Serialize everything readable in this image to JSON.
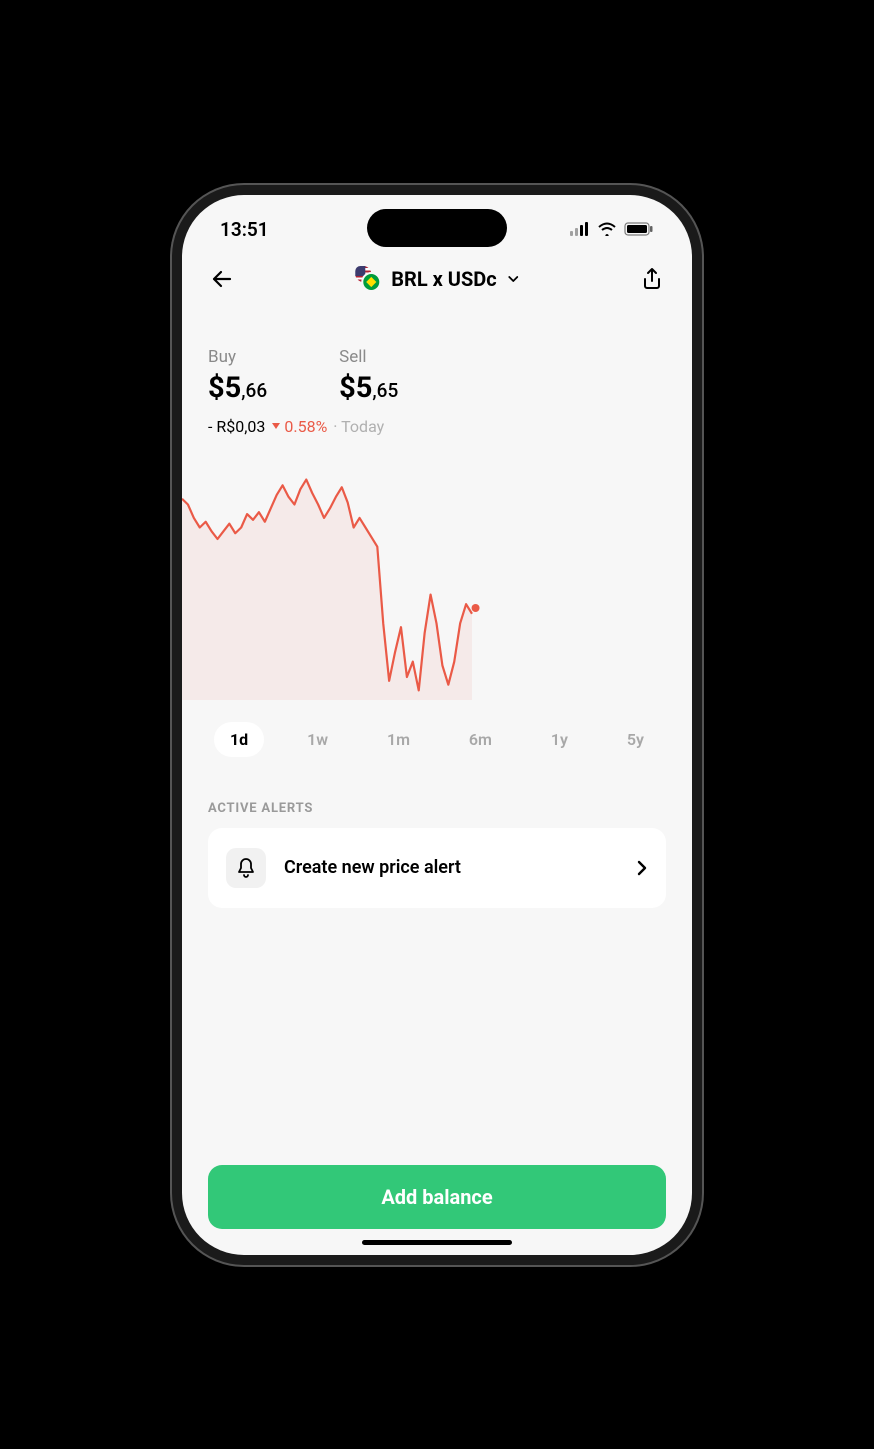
{
  "status_bar": {
    "time": "13:51"
  },
  "header": {
    "pair": "BRL x USDc"
  },
  "prices": {
    "buy_label": "Buy",
    "buy_major": "$5",
    "buy_minor": ",66",
    "sell_label": "Sell",
    "sell_major": "$5",
    "sell_minor": ",65"
  },
  "change": {
    "delta": "- R$0,03",
    "pct": "0.58%",
    "period_prefix": "· ",
    "period": "Today"
  },
  "chart_data": {
    "type": "line",
    "title": "",
    "xlabel": "",
    "ylabel": "",
    "ylim": [
      5.6,
      5.72
    ],
    "x": [
      0,
      1,
      2,
      3,
      4,
      5,
      6,
      7,
      8,
      9,
      10,
      11,
      12,
      13,
      14,
      15,
      16,
      17,
      18,
      19,
      20,
      21,
      22,
      23,
      24,
      25,
      26,
      27,
      28,
      29,
      30,
      31,
      32,
      33,
      34,
      35,
      36,
      37,
      38,
      39,
      40,
      41,
      42,
      43,
      44,
      45,
      46,
      47,
      48,
      49
    ],
    "values": [
      5.705,
      5.702,
      5.695,
      5.69,
      5.693,
      5.688,
      5.684,
      5.688,
      5.692,
      5.687,
      5.69,
      5.697,
      5.694,
      5.698,
      5.693,
      5.7,
      5.707,
      5.712,
      5.706,
      5.702,
      5.71,
      5.715,
      5.708,
      5.702,
      5.695,
      5.7,
      5.706,
      5.711,
      5.703,
      5.69,
      5.695,
      5.69,
      5.685,
      5.68,
      5.64,
      5.61,
      5.625,
      5.638,
      5.612,
      5.62,
      5.605,
      5.635,
      5.655,
      5.64,
      5.618,
      5.608,
      5.62,
      5.64,
      5.65,
      5.645
    ],
    "current_point": {
      "x": 49.6,
      "y": 5.648
    },
    "color": "#ea5a47"
  },
  "ranges": {
    "options": [
      "1d",
      "1w",
      "1m",
      "6m",
      "1y",
      "5y"
    ],
    "active": "1d"
  },
  "alerts": {
    "heading": "ACTIVE ALERTS",
    "create_label": "Create new price alert"
  },
  "cta": {
    "label": "Add balance"
  },
  "colors": {
    "accent": "#32c878",
    "down": "#ea5a47"
  }
}
